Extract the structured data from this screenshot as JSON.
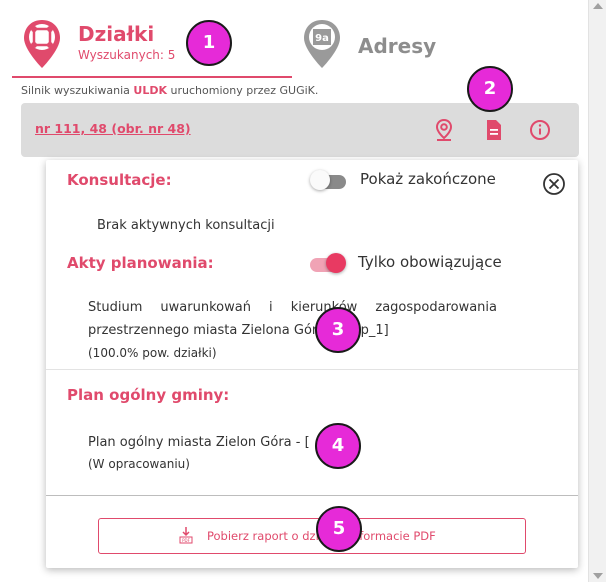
{
  "tabs": [
    {
      "label": "Działki",
      "sublabel": "Wyszukanych: 5",
      "icon": "parcel-pin-icon",
      "active": true
    },
    {
      "label": "Adresy",
      "icon": "address-pin-icon",
      "active": false
    }
  ],
  "engine_note": {
    "prefix": "Silnik wyszukiwania ",
    "engine": "ULDK",
    "suffix": " uruchomiony przez GUGiK."
  },
  "parcel": {
    "label": "nr 111, 48 (obr. nr 48)",
    "actions": [
      {
        "icon": "map-pin-icon"
      },
      {
        "icon": "document-icon"
      },
      {
        "icon": "info-icon"
      }
    ]
  },
  "consultations": {
    "title": "Konsultacje:",
    "toggle_label": "Pokaż zakończone",
    "toggle_on": false,
    "empty_text": "Brak aktywnych konsultacji"
  },
  "planning_acts": {
    "title": "Akty planowania:",
    "toggle_label": "Tylko obowiązujące",
    "toggle_on": true,
    "item_line1": "Studium uwarunkowań i kierunków zagospodarowania",
    "item_line2": "przestrzennego miasta Zielona Góra [uikzp_1]",
    "item_share": "(100.0% pow. działki)"
  },
  "general_plan": {
    "title": "Plan ogólny gminy:",
    "item_name": "Plan ogólny miasta Zielon Góra - [",
    "item_status": "(W opracowaniu)"
  },
  "pdf_button": {
    "label": "Pobierz raport o działce w formacie PDF",
    "icon": "pdf-download-icon"
  },
  "badges": [
    "1",
    "2",
    "3",
    "4",
    "5"
  ],
  "colors": {
    "accent": "#e04a6c",
    "badge": "#e62ad8",
    "bar": "#dcdcdc"
  }
}
